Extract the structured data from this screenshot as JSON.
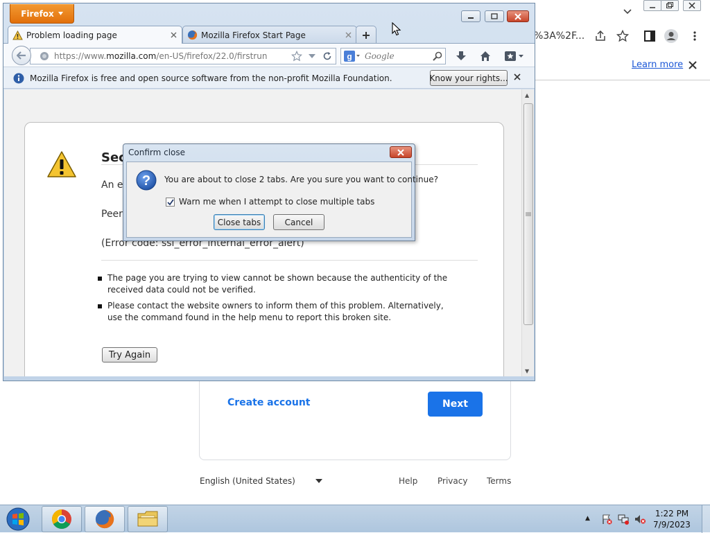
{
  "chrome": {
    "url_tail": "%3A%2F...",
    "learn_more": "Learn more",
    "google": {
      "create_account": "Create account",
      "next": "Next",
      "language": "English (United States)",
      "footer": [
        "Help",
        "Privacy",
        "Terms"
      ],
      "accent": "#1a73e8"
    }
  },
  "firefox": {
    "menu_label": "Firefox",
    "tabs": [
      {
        "label": "Problem loading page",
        "icon": "warning-icon"
      },
      {
        "label": "Mozilla Firefox Start Page",
        "icon": "firefox-icon"
      }
    ],
    "url": {
      "prefix": "https://www.",
      "domain": "mozilla.com",
      "path": "/en-US/firefox/22.0/firstrun"
    },
    "search_placeholder": "Google",
    "notice": {
      "text": "Mozilla Firefox is free and open source software from the non-profit Mozilla Foundation.",
      "button": "Know your rights..."
    },
    "error_page": {
      "title": "Sec",
      "long_desc": "An e",
      "peer": "Peer",
      "code": "(Error code: ssl_error_internal_error_alert)",
      "bullets": [
        "The page you are trying to view cannot be shown because the authenticity of the received data could not be verified.",
        "Please contact the website owners to inform them of this problem. Alternatively, use the command found in the help menu to report this broken site."
      ],
      "try_again": "Try Again"
    }
  },
  "dialog": {
    "title": "Confirm close",
    "message": "You are about to close 2 tabs. Are you sure you want to continue?",
    "checkbox_label": "Warn me when I attempt to close multiple tabs",
    "checkbox_checked": true,
    "close_tabs": "Close tabs",
    "cancel": "Cancel"
  },
  "taskbar": {
    "apps": [
      "chrome-icon",
      "firefox-icon",
      "explorer-folder-icon"
    ],
    "time": "1:22 PM",
    "date": "7/9/2023"
  }
}
